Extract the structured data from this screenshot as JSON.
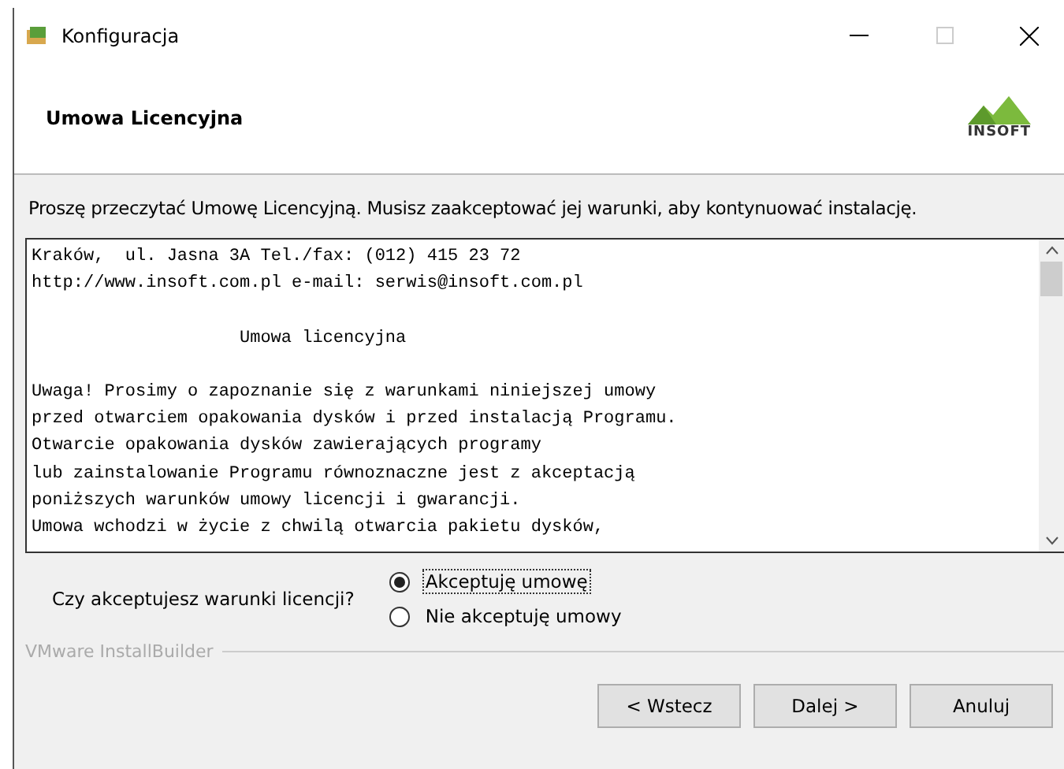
{
  "window": {
    "title": "Konfiguracja"
  },
  "header": {
    "title": "Umowa Licencyjna",
    "logo_text": "INSOFT"
  },
  "intro": "Proszę przeczytać Umowę Licencyjną. Musisz zaakceptować jej warunki, aby kontynuować instalację.",
  "license_blocks": [
    {
      "kind": "text",
      "lines": [
        "Kraków,  ul. Jasna 3A Tel./fax: (012) 415 23 72",
        "http://www.insoft.com.pl e-mail: serwis@insoft.com.pl"
      ]
    },
    {
      "kind": "heading",
      "lines": [
        "Umowa licencyjna"
      ]
    },
    {
      "kind": "text",
      "lines": [
        "Uwaga! Prosimy o zapoznanie się z warunkami niniejszej umowy",
        "przed otwarciem opakowania dysków i przed instalacją Programu.",
        "Otwarcie opakowania dysków zawierających programy",
        "lub zainstalowanie Programu równoznaczne jest z akceptacją",
        "poniższych warunków umowy licencji i gwarancji.",
        "Umowa wchodzi w życie z chwilą otwarcia pakietu dysków,"
      ]
    }
  ],
  "question": "Czy akceptujesz warunki licencji?",
  "options": [
    {
      "label": "Akceptuję umowę",
      "selected": true
    },
    {
      "label": "Nie akceptuję umowy",
      "selected": false
    }
  ],
  "footer_brand": "VMware InstallBuilder",
  "buttons": [
    "< Wstecz",
    "Dalej >",
    "Anuluj"
  ]
}
